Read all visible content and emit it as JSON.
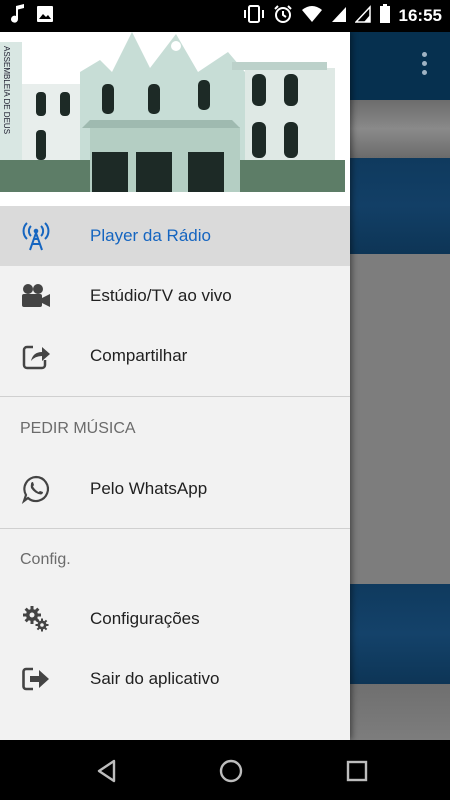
{
  "status_bar": {
    "time": "16:55",
    "icons": [
      "music-note-icon",
      "image-icon",
      "vibrate-icon",
      "alarm-icon",
      "wifi-icon",
      "signal-icon",
      "signal-icon",
      "battery-icon"
    ]
  },
  "header": {
    "building_sign": "ASSEMBLEIA DE DEUS"
  },
  "drawer": {
    "items": [
      {
        "label": "Player da Rádio",
        "icon": "radio-tower-icon",
        "active": true
      },
      {
        "label": "Estúdio/TV ao vivo",
        "icon": "video-camera-icon",
        "active": false
      },
      {
        "label": "Compartilhar",
        "icon": "share-icon",
        "active": false
      }
    ],
    "section_request": {
      "title": "PEDIR MÚSICA",
      "items": [
        {
          "label": "Pelo WhatsApp",
          "icon": "whatsapp-icon"
        }
      ]
    },
    "section_config": {
      "title": "Config.",
      "items": [
        {
          "label": "Configurações",
          "icon": "gears-icon"
        },
        {
          "label": "Sair do aplicativo",
          "icon": "exit-icon"
        }
      ]
    }
  },
  "colors": {
    "accent": "#1565c0",
    "toolbar_bg": "#06304f",
    "drawer_bg": "#f2f2f2",
    "active_item_bg": "#dadada"
  },
  "nav_bar": {
    "buttons": [
      "back-icon",
      "home-icon",
      "recents-icon"
    ]
  }
}
